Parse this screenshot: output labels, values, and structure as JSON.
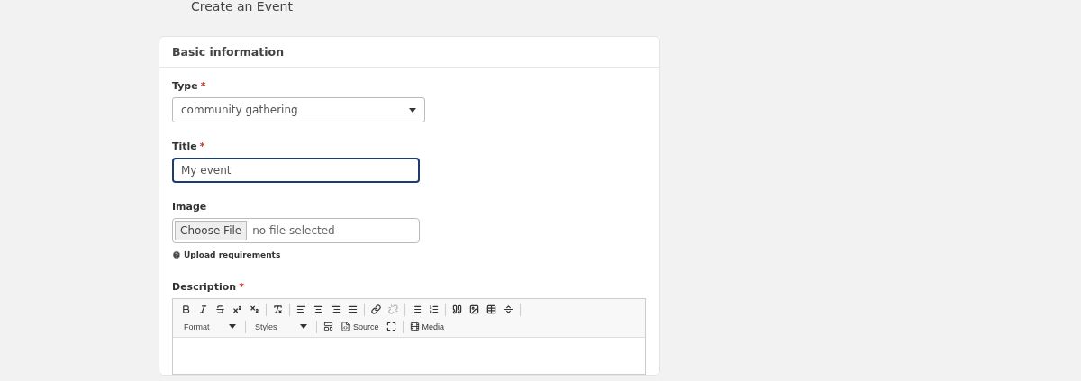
{
  "page_title": "Create an Event",
  "card": {
    "title": "Basic information",
    "type_field": {
      "label": "Type",
      "required_mark": "*",
      "value": "community gathering"
    },
    "title_field": {
      "label": "Title",
      "required_mark": "*",
      "value": "My event",
      "focused": true
    },
    "image_field": {
      "label": "Image",
      "button": "Choose File",
      "status": "no file selected",
      "help": "Upload requirements"
    },
    "description": {
      "label": "Description",
      "required_mark": "*",
      "toolbar_buttons": [
        {
          "disabled": false
        },
        {
          "disabled": false
        },
        {
          "disabled": false
        },
        {
          "disabled": false
        },
        {
          "disabled": false
        },
        {
          "disabled": false
        },
        {
          "disabled": false
        },
        {
          "disabled": false
        },
        {
          "disabled": false
        },
        {
          "disabled": false
        },
        {
          "disabled": false
        },
        {
          "disabled": true
        },
        {
          "disabled": false
        },
        {
          "disabled": false
        },
        {
          "disabled": false
        },
        {
          "disabled": false
        },
        {
          "disabled": false
        },
        {
          "disabled": false
        }
      ],
      "format_menu": "Format",
      "styles_menu": "Styles",
      "source_button": "Source",
      "media_button": "Media"
    }
  }
}
